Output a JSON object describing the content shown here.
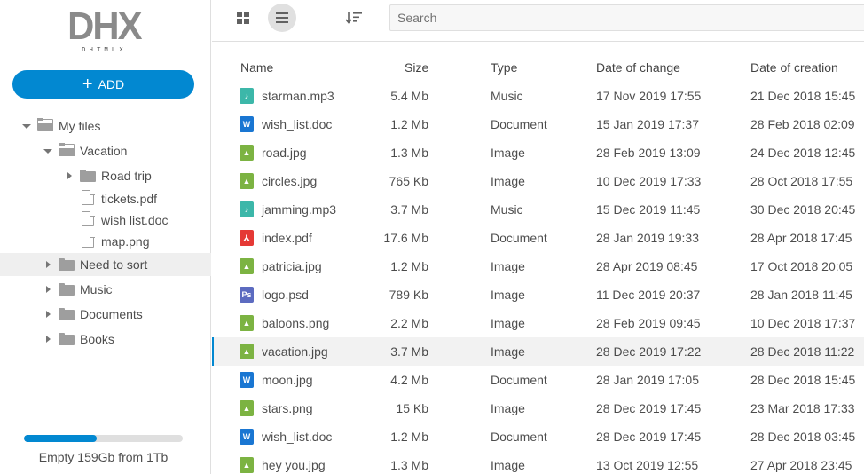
{
  "logo": {
    "big": "DHX",
    "small": "DHTMLX"
  },
  "add_button": {
    "label": "ADD"
  },
  "tree": [
    {
      "label": "My files",
      "kind": "folder-open",
      "caret": "down",
      "level": 0
    },
    {
      "label": "Vacation",
      "kind": "folder-open",
      "caret": "down",
      "level": 1
    },
    {
      "label": "Road trip",
      "kind": "folder-closed",
      "caret": "right",
      "level": 2
    },
    {
      "label": "tickets.pdf",
      "kind": "file",
      "caret": "",
      "level": 2
    },
    {
      "label": "wish list.doc",
      "kind": "file",
      "caret": "",
      "level": 2
    },
    {
      "label": "map.png",
      "kind": "file",
      "caret": "",
      "level": 2
    },
    {
      "label": "Need to sort",
      "kind": "folder-closed",
      "caret": "right",
      "level": 1,
      "selected": true
    },
    {
      "label": "Music",
      "kind": "folder-closed",
      "caret": "right",
      "level": 1
    },
    {
      "label": "Documents",
      "kind": "folder-closed",
      "caret": "right",
      "level": 1
    },
    {
      "label": "Books",
      "kind": "folder-closed",
      "caret": "right",
      "level": 1
    }
  ],
  "storage": {
    "text": "Empty 159Gb from 1Tb",
    "used_fraction": 0.52
  },
  "toolbar": {
    "grid_view_icon": "grid-icon",
    "list_view_icon": "list-icon",
    "sort_icon": "sort-icon",
    "search_placeholder": "Search"
  },
  "columns": {
    "name": "Name",
    "size": "Size",
    "type": "Type",
    "changed": "Date of change",
    "created": "Date of creation"
  },
  "files": [
    {
      "name": "starman.mp3",
      "size": "5.4 Mb",
      "type": "Music",
      "changed": "17 Nov 2019 17:55",
      "created": "21 Dec 2018 15:45",
      "icon": "music"
    },
    {
      "name": "wish_list.doc",
      "size": "1.2 Mb",
      "type": "Document",
      "changed": "15 Jan 2019 17:37",
      "created": "28 Feb 2018 02:09",
      "icon": "doc"
    },
    {
      "name": "road.jpg",
      "size": "1.3 Mb",
      "type": "Image",
      "changed": "28 Feb 2019 13:09",
      "created": "24 Dec 2018 12:45",
      "icon": "image"
    },
    {
      "name": "circles.jpg",
      "size": "765 Kb",
      "type": "Image",
      "changed": "10 Dec 2019 17:33",
      "created": "28 Oct 2018 17:55",
      "icon": "image"
    },
    {
      "name": "jamming.mp3",
      "size": "3.7 Mb",
      "type": "Music",
      "changed": "15 Dec 2019 11:45",
      "created": "30 Dec 2018 20:45",
      "icon": "music"
    },
    {
      "name": "index.pdf",
      "size": "17.6 Mb",
      "type": "Document",
      "changed": "28 Jan 2019 19:33",
      "created": "28 Apr 2018 17:45",
      "icon": "pdf"
    },
    {
      "name": "patricia.jpg",
      "size": "1.2 Mb",
      "type": "Image",
      "changed": "28 Apr 2019 08:45",
      "created": "17 Oct 2018 20:05",
      "icon": "image"
    },
    {
      "name": "logo.psd",
      "size": "789 Kb",
      "type": "Image",
      "changed": "11 Dec 2019 20:37",
      "created": "28 Jan 2018 11:45",
      "icon": "psd"
    },
    {
      "name": "baloons.png",
      "size": "2.2 Mb",
      "type": "Image",
      "changed": "28 Feb 2019 09:45",
      "created": "10 Dec 2018 17:37",
      "icon": "image"
    },
    {
      "name": "vacation.jpg",
      "size": "3.7 Mb",
      "type": "Image",
      "changed": "28 Dec 2019 17:22",
      "created": "28 Dec 2018 11:22",
      "icon": "image",
      "highlight": true
    },
    {
      "name": "moon.jpg",
      "size": "4.2 Mb",
      "type": "Document",
      "changed": "28 Jan 2019 17:05",
      "created": "28 Dec 2018 15:45",
      "icon": "doc"
    },
    {
      "name": "stars.png",
      "size": "15 Kb",
      "type": "Image",
      "changed": "28 Dec 2019 17:45",
      "created": "23 Mar 2018 17:33",
      "icon": "image"
    },
    {
      "name": "wish_list.doc",
      "size": "1.2 Mb",
      "type": "Document",
      "changed": "28 Dec 2019 17:45",
      "created": "28 Dec 2018 03:45",
      "icon": "doc"
    },
    {
      "name": "hey you.jpg",
      "size": "1.3 Mb",
      "type": "Image",
      "changed": "13 Oct 2019 12:55",
      "created": "27 Apr 2018 23:45",
      "icon": "image"
    }
  ],
  "colors": {
    "accent": "#0288d1",
    "music": "#3cb7a9",
    "image": "#7cb342",
    "doc": "#1976d2",
    "pdf": "#e53935",
    "psd": "#5c6bc0"
  }
}
